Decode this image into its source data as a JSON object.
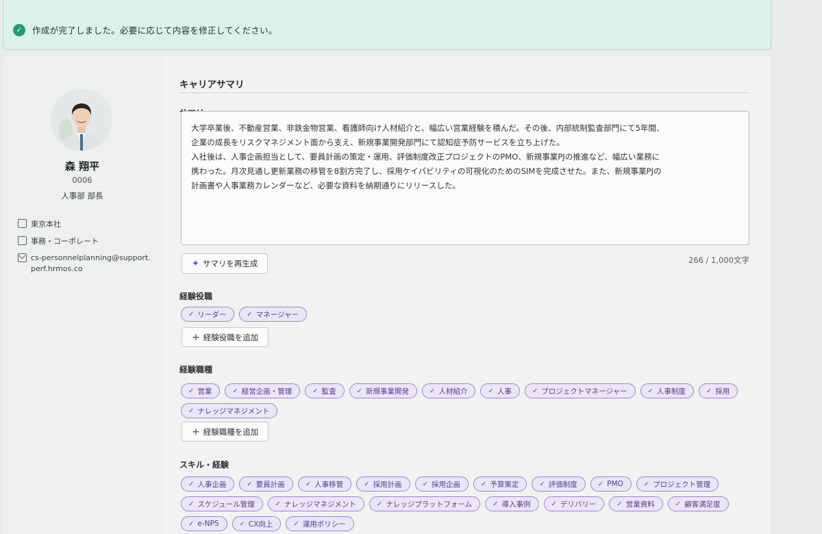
{
  "banner": {
    "message": "作成が完了しました。必要に応じて内容を修正してください。"
  },
  "profile": {
    "name": "森 翔平",
    "employee_id": "0006",
    "role": "人事部 部長",
    "office": "東京本社",
    "department": "事務・コーポレート",
    "email": "cs-personnelplanning@support.perf.hrmos.co"
  },
  "career": {
    "section_title": "キャリアサマリ",
    "summary_label": "サマリ",
    "summary_text": "大学卒業後、不動産営業、非鉄金物営業、看護師向け人材紹介と、幅広い営業経験を積んだ。その後、内部統制監査部門にて5年間、\n企業の成長をリスクマネジメント面から支え、新規事業開発部門にて認知症予防サービスを立ち上げた。\n入社後は、人事企画担当として、要員計画の策定・運用、評価制度改正プロジェクトのPMO、新規事業PJの推進など、幅広い業務に\n携わった。月次見通し更新業務の移管を8割方完了し、採用ケイパビリティの可視化のためのSIMを完成させた。また、新規事業PJの\n計画書や人事業務カレンダーなど、必要な資料を納期通りにリリースした。",
    "regenerate_label": "サマリを再生成",
    "char_count": "266 / 1,000文字"
  },
  "roles": {
    "label": "経験役職",
    "tags": [
      "リーダー",
      "マネージャー"
    ],
    "add_label": "経験役職を追加"
  },
  "job_types": {
    "label": "経験職種",
    "tags": [
      "営業",
      "経営企画・管理",
      "監査",
      "新規事業開発",
      "人材紹介",
      "人事",
      "プロジェクトマネージャー",
      "人事制度",
      "採用",
      "ナレッジマネジメント"
    ],
    "add_label": "経験職種を追加"
  },
  "skills": {
    "label": "スキル・経験",
    "tags": [
      "人事企画",
      "要員計画",
      "人事移管",
      "採用計画",
      "採用企画",
      "予算策定",
      "評価制度",
      "PMO",
      "プロジェクト管理",
      "スケジュール管理",
      "ナレッジマネジメント",
      "ナレッジプラットフォーム",
      "導入事例",
      "デリバリー",
      "営業資料",
      "顧客満足度",
      "e-NPS",
      "CX向上",
      "運用ポリシー"
    ]
  },
  "colors": {
    "accent": "#6d4fc7",
    "success": "#1f9e6e",
    "tag_border": "#9a84d8"
  }
}
